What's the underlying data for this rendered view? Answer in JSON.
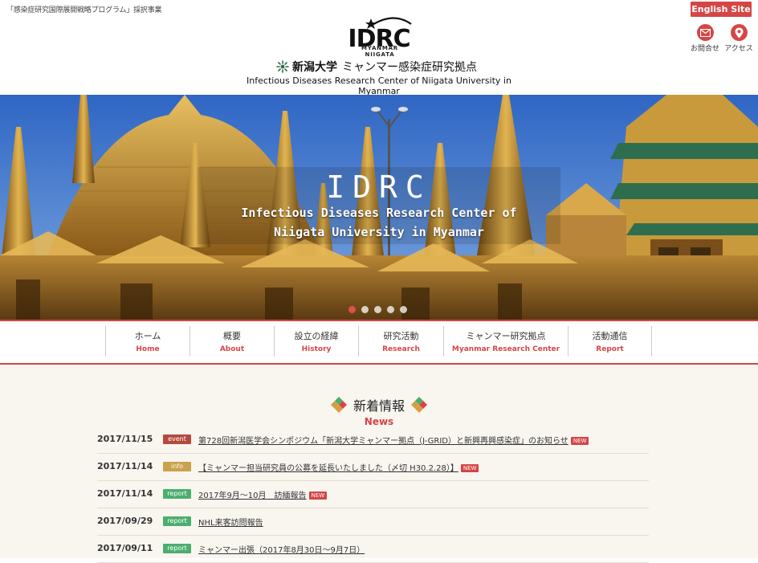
{
  "header": {
    "tagline": "「感染症研究国際展開戦略プログラム」採択事業",
    "english_site": "English Site",
    "contact_label": "お問合せ",
    "access_label": "アクセス",
    "logo_text": "IDRC",
    "logo_sub": "MYANMAR NIIGATA",
    "univ_name": "新潟大学",
    "center_jp": "ミャンマー感染症研究拠点",
    "center_en": "Infectious Diseases Research Center of Niigata University in Myanmar"
  },
  "hero": {
    "title": "IDRC",
    "subtitle_line1": "Infectious Diseases Research Center of",
    "subtitle_line2": "Niigata University in Myanmar",
    "slide_count": 5,
    "active_slide": 1
  },
  "nav": {
    "items": [
      {
        "jp": "ホーム",
        "en": "Home"
      },
      {
        "jp": "概要",
        "en": "About"
      },
      {
        "jp": "設立の経緯",
        "en": "History"
      },
      {
        "jp": "研究活動",
        "en": "Research"
      },
      {
        "jp": "ミャンマー研究拠点",
        "en": "Myanmar Research Center"
      },
      {
        "jp": "活動通信",
        "en": "Report"
      }
    ]
  },
  "news": {
    "heading_jp": "新着情報",
    "heading_en": "News",
    "new_label": "NEW",
    "items": [
      {
        "date": "2017/11/15",
        "category": "event",
        "title": "第728回新潟医学会シンポジウム「新潟大学ミャンマー拠点（J-GRID）と新興再興感染症」のお知らせ",
        "is_new": true
      },
      {
        "date": "2017/11/14",
        "category": "info",
        "title": "【ミャンマー担当研究員の公募を延長いたしました（〆切 H30.2.28）】",
        "is_new": true
      },
      {
        "date": "2017/11/14",
        "category": "report",
        "title": "2017年9月～10月　訪緬報告",
        "is_new": true
      },
      {
        "date": "2017/09/29",
        "category": "report",
        "title": "NHL来客訪問報告",
        "is_new": false
      },
      {
        "date": "2017/09/11",
        "category": "report",
        "title": "ミャンマー出張（2017年8月30日～9月7日）",
        "is_new": false
      }
    ]
  },
  "colors": {
    "accent": "#d64545",
    "event": "#b34a3d",
    "info": "#c9a24a",
    "report": "#4cae6e"
  }
}
